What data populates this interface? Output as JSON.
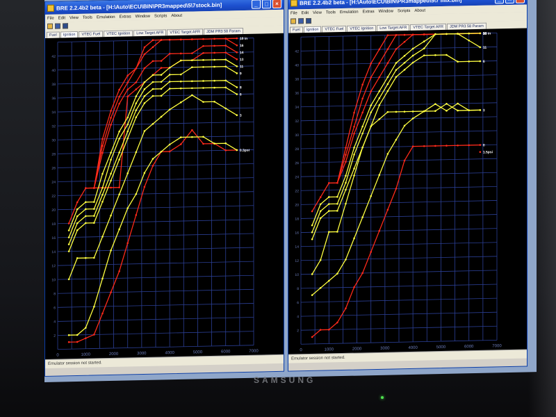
{
  "colors": {
    "titlebar": "#1d50cf",
    "red": "#ff2a1a",
    "yellow": "#ffff40",
    "grid": "#2b3f95",
    "axis_text": "#6a7bb8"
  },
  "brand": "SAMSUNG",
  "windows": [
    {
      "title": "BRE 2.2.4b2 beta - [H:\\Auto\\ECU\\BIN\\PR3mapped\\5\\7stock.bin]",
      "menu": [
        "File",
        "Edit",
        "View",
        "Tools",
        "Emulation",
        "Extras",
        "Window",
        "Scripts",
        "About"
      ],
      "tools": [
        "open-icon",
        "save-icon",
        "save-as-icon"
      ],
      "tabs": [
        "Fuel",
        "Ignition",
        "VTEC Fuel",
        "VTEC Ignition",
        "Low Target AFR",
        "VTEC Target AFR",
        "JDM PR3 58 Param"
      ],
      "active_tab": 1,
      "status": "Emulator session not started.",
      "chart_data": {
        "type": "line",
        "xlim": [
          0,
          7000
        ],
        "ylim": [
          0,
          44
        ],
        "xticks": [
          "0",
          "1000",
          "2000",
          "3000",
          "4000",
          "5000",
          "6000",
          "7000"
        ],
        "yticks": [
          "2",
          "4",
          "6",
          "8",
          "10",
          "12",
          "14",
          "16",
          "18",
          "20",
          "22",
          "24",
          "26",
          "28",
          "30",
          "32",
          "34",
          "36",
          "38",
          "40",
          "42"
        ],
        "x": [
          400,
          700,
          1000,
          1300,
          1600,
          1900,
          2200,
          2500,
          2800,
          3100,
          3400,
          3700,
          4000,
          4400,
          4800,
          5200,
          5600,
          6000,
          6400
        ],
        "series": [
          {
            "name": "18 in",
            "color": "red",
            "values": [
              18,
              21,
              23,
              23,
              30,
              34,
              37,
              39,
              40,
              43,
              45,
              45,
              46,
              47,
              47,
              46,
              47,
              46,
              45
            ]
          },
          {
            "name": "16",
            "color": "red",
            "values": [
              null,
              null,
              23,
              23,
              29,
              33,
              36,
              38,
              40,
              42,
              43,
              44,
              44,
              45,
              45,
              44,
              44,
              44,
              43
            ]
          },
          {
            "name": "14",
            "color": "red",
            "values": [
              null,
              null,
              null,
              23,
              28,
              32,
              35,
              37,
              38,
              40,
              41,
              41,
              42,
              42,
              42,
              43,
              43,
              43,
              42
            ]
          },
          {
            "name": "13",
            "color": "red",
            "values": [
              null,
              null,
              null,
              23,
              23,
              23,
              23,
              36,
              37,
              38,
              39,
              40,
              40,
              41,
              41,
              42,
              42,
              42,
              41
            ]
          },
          {
            "name": "11",
            "color": "yellow",
            "values": [
              17,
              20,
              21,
              21,
              25,
              28,
              31,
              33,
              36,
              38,
              39,
              39,
              40,
              41,
              41,
              41,
              41,
              41,
              40
            ]
          },
          {
            "name": "9",
            "color": "yellow",
            "values": [
              16,
              19,
              20,
              20,
              23,
              27,
              30,
              32,
              35,
              37,
              38,
              38,
              39,
              39,
              40,
              40,
              40,
              40,
              39
            ]
          },
          {
            "name": "8",
            "color": "yellow",
            "values": [
              15,
              18,
              19,
              19,
              22,
              25,
              28,
              31,
              34,
              36,
              37,
              37,
              38,
              38,
              38,
              38,
              38,
              38,
              37
            ]
          },
          {
            "name": "6",
            "color": "yellow",
            "values": [
              14,
              17,
              18,
              18,
              21,
              24,
              27,
              30,
              33,
              35,
              36,
              36,
              37,
              37,
              37,
              37,
              37,
              37,
              36
            ]
          },
          {
            "name": "3",
            "color": "yellow",
            "values": [
              10,
              13,
              13,
              13,
              16,
              19,
              22,
              25,
              28,
              31,
              32,
              33,
              34,
              35,
              36,
              35,
              35,
              34,
              33
            ]
          },
          {
            "name": "0.3psi",
            "color": "red",
            "values": [
              1,
              1,
              1.5,
              2,
              5,
              8,
              11,
              15,
              19,
              23,
              26,
              28,
              28,
              29,
              31,
              29,
              29,
              28,
              28
            ]
          },
          {
            "name": "",
            "color": "yellow",
            "values": [
              2,
              2,
              3,
              6,
              10,
              14,
              17,
              20,
              22,
              25,
              27,
              28,
              29,
              30,
              30,
              30,
              29,
              29,
              28
            ]
          }
        ]
      }
    },
    {
      "title": "BRE 2.2.4b2 beta - [H:\\Auto\\ECU\\BIN\\PR3mapped\\5\\7 mix.bin]",
      "menu": [
        "File",
        "Edit",
        "View",
        "Tools",
        "Emulation",
        "Extras",
        "Window",
        "Scripts",
        "About"
      ],
      "tools": [
        "open-icon",
        "save-icon",
        "save-as-icon"
      ],
      "tabs": [
        "Fuel",
        "Ignition",
        "VTEC Fuel",
        "VTEC Ignition",
        "Low Target AFR",
        "VTEC Target AFR",
        "JDM PR3 58 Param"
      ],
      "active_tab": 1,
      "status": "Emulator session not started.",
      "chart_data": {
        "type": "line",
        "xlim": [
          0,
          7000
        ],
        "ylim": [
          0,
          44
        ],
        "xticks": [
          "0",
          "1000",
          "2000",
          "3000",
          "4000",
          "5000",
          "6000",
          "7000"
        ],
        "yticks": [
          "2",
          "4",
          "6",
          "8",
          "10",
          "12",
          "14",
          "16",
          "18",
          "20",
          "22",
          "24",
          "26",
          "28",
          "30",
          "32",
          "34",
          "36",
          "38",
          "40",
          "42"
        ],
        "x": [
          400,
          700,
          1000,
          1300,
          1600,
          1900,
          2200,
          2500,
          2800,
          3100,
          3400,
          3700,
          4000,
          4400,
          4800,
          5200,
          5600,
          6000,
          6400
        ],
        "series": [
          {
            "name": "18 in",
            "color": "red",
            "values": [
              19,
              21,
              23,
              23,
              28,
              33,
              37,
              40,
              42,
              44,
              46,
              47,
              48,
              49,
              49,
              49,
              49,
              48,
              48
            ]
          },
          {
            "name": "16",
            "color": "red",
            "values": [
              null,
              null,
              23,
              23,
              27,
              31,
              35,
              38,
              40,
              42,
              44,
              45,
              46,
              47,
              47,
              47,
              47,
              47,
              47
            ]
          },
          {
            "name": "13",
            "color": "red",
            "values": [
              null,
              null,
              null,
              23,
              26,
              30,
              33,
              36,
              38,
              40,
              42,
              43,
              44,
              45,
              45,
              45,
              46,
              46,
              46
            ]
          },
          {
            "name": "9",
            "color": "yellow",
            "values": [
              17,
              20,
              21,
              21,
              24,
              28,
              31,
              34,
              36,
              38,
              40,
              41,
              42,
              43,
              44,
              45,
              45,
              44,
              44
            ]
          },
          {
            "name": "11",
            "color": "yellow",
            "values": [
              16,
              19,
              20,
              20,
              23,
              27,
              30,
              33,
              35,
              37,
              39,
              40,
              41,
              42,
              44,
              46,
              44,
              43,
              42
            ]
          },
          {
            "name": "6",
            "color": "yellow",
            "values": [
              15,
              18,
              19,
              19,
              22,
              25,
              28,
              31,
              34,
              36,
              38,
              39,
              40,
              41,
              41,
              41,
              40,
              40,
              40
            ]
          },
          {
            "name": "3",
            "color": "yellow",
            "values": [
              10,
              12,
              16,
              16,
              20,
              24,
              28,
              31,
              32,
              33,
              33,
              33,
              33,
              33,
              34,
              33,
              34,
              33,
              33
            ]
          },
          {
            "name": "0",
            "color": "red",
            "values": [
              1,
              2,
              2,
              3,
              5,
              8,
              10,
              13,
              16,
              19,
              22,
              26,
              28,
              28,
              28,
              28,
              28,
              28,
              28
            ]
          },
          {
            "name": "1.5psi",
            "color": "red",
            "values": [
              null,
              null,
              null,
              null,
              null,
              null,
              null,
              null,
              null,
              null,
              null,
              null,
              null,
              null,
              null,
              null,
              null,
              null,
              27
            ]
          },
          {
            "name": "",
            "color": "yellow",
            "values": [
              7,
              8,
              9,
              10,
              12,
              15,
              18,
              21,
              24,
              27,
              29,
              31,
              32,
              33,
              33,
              34,
              33,
              33,
              33
            ]
          }
        ]
      }
    }
  ]
}
